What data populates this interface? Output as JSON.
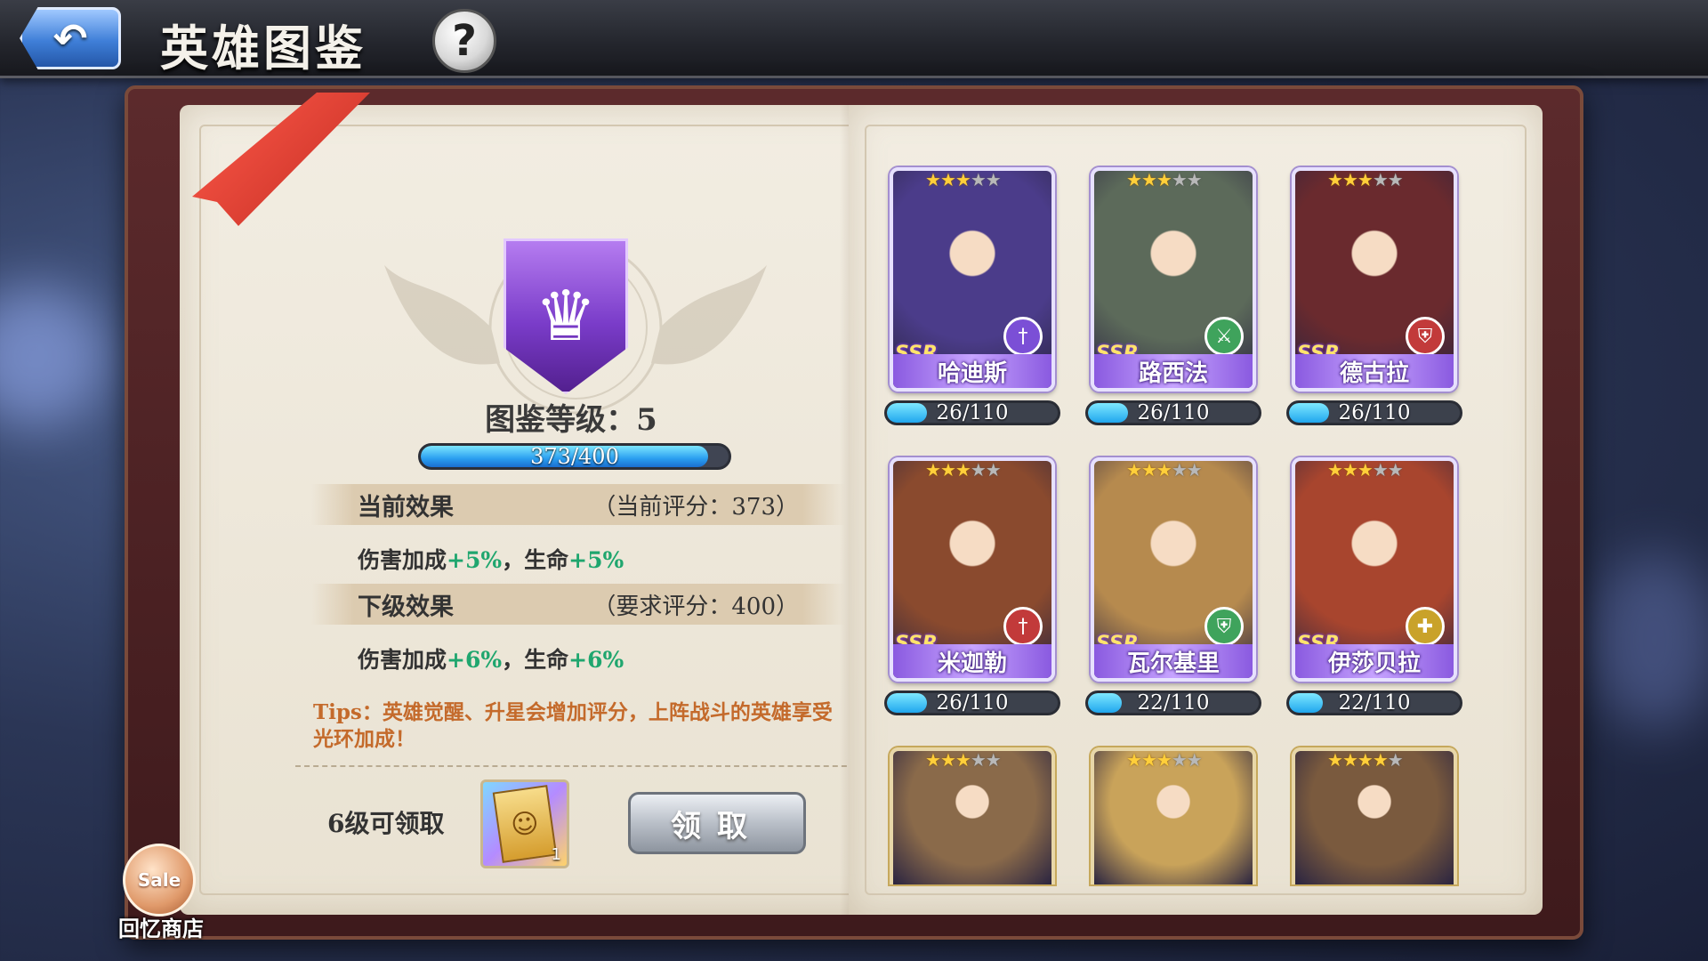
{
  "header": {
    "back_icon": "↶",
    "title": "英雄图鉴",
    "help_icon": "?"
  },
  "codex": {
    "emblem_icon": "♛",
    "level_label": "图鉴等级：5",
    "exp_text": "373/400",
    "exp_fraction": 0.9325,
    "current": {
      "title": "当前效果",
      "score": "（当前评分：373）",
      "effect_prefix": "伤害加成",
      "effect_dmg": "+5%",
      "effect_mid": "，生命",
      "effect_hp": "+5%"
    },
    "next": {
      "title": "下级效果",
      "score": "（要求评分：400）",
      "effect_prefix": "伤害加成",
      "effect_dmg": "+6%",
      "effect_mid": "，生命",
      "effect_hp": "+6%"
    },
    "tips": "Tips：英雄觉醒、升星会增加评分，上阵战斗的英雄享受光环加成！",
    "reward_label": "6级可领取",
    "reward_count": "1",
    "claim_label": "领取"
  },
  "shop": {
    "icon_text": "Sale",
    "label": "回忆商店"
  },
  "colors": {
    "accent_green": "#1fa66e",
    "progress_blue": "#20a6ee",
    "rarity_purple": "#8a5ae0"
  },
  "heroes": [
    {
      "name": "哈迪斯",
      "rarity": "SSR",
      "stars": 3,
      "max_stars": 5,
      "shards": "26/110",
      "shard_fraction": 0.236,
      "class_icon": "sword-icon",
      "class_glyph": "†",
      "class_color": "#7b4fd6",
      "bg": "#4b3c8a"
    },
    {
      "name": "路西法",
      "rarity": "SSR",
      "stars": 3,
      "max_stars": 5,
      "shards": "26/110",
      "shard_fraction": 0.236,
      "class_icon": "crossed-swords-icon",
      "class_glyph": "⚔",
      "class_color": "#3fa35c",
      "bg": "#5c6a5a"
    },
    {
      "name": "德古拉",
      "rarity": "SSR",
      "stars": 3,
      "max_stars": 5,
      "shards": "26/110",
      "shard_fraction": 0.236,
      "class_icon": "shield-icon",
      "class_glyph": "⛨",
      "class_color": "#c23a3a",
      "bg": "#6a2a2e"
    },
    {
      "name": "米迦勒",
      "rarity": "SSR",
      "stars": 3,
      "max_stars": 5,
      "shards": "26/110",
      "shard_fraction": 0.236,
      "class_icon": "sword-icon",
      "class_glyph": "†",
      "class_color": "#c23a3a",
      "bg": "#8a4a2e"
    },
    {
      "name": "瓦尔基里",
      "rarity": "SSR",
      "stars": 3,
      "max_stars": 5,
      "shards": "22/110",
      "shard_fraction": 0.2,
      "class_icon": "shield-icon",
      "class_glyph": "⛨",
      "class_color": "#3fa35c",
      "bg": "#b68a4e"
    },
    {
      "name": "伊莎贝拉",
      "rarity": "SSR",
      "stars": 3,
      "max_stars": 5,
      "shards": "22/110",
      "shard_fraction": 0.2,
      "class_icon": "cross-icon",
      "class_glyph": "✚",
      "class_color": "#c9a22a",
      "bg": "#a8452e"
    },
    {
      "name": "",
      "rarity": "",
      "stars": 3,
      "max_stars": 5,
      "shards": "",
      "shard_fraction": 0,
      "class_icon": "",
      "class_glyph": "",
      "class_color": "",
      "bg": "#8a6a4a"
    },
    {
      "name": "",
      "rarity": "",
      "stars": 3,
      "max_stars": 5,
      "shards": "",
      "shard_fraction": 0,
      "class_icon": "",
      "class_glyph": "",
      "class_color": "",
      "bg": "#c9a35a"
    },
    {
      "name": "",
      "rarity": "",
      "stars": 4,
      "max_stars": 5,
      "shards": "",
      "shard_fraction": 0,
      "class_icon": "",
      "class_glyph": "",
      "class_color": "",
      "bg": "#7a5a3e"
    }
  ]
}
